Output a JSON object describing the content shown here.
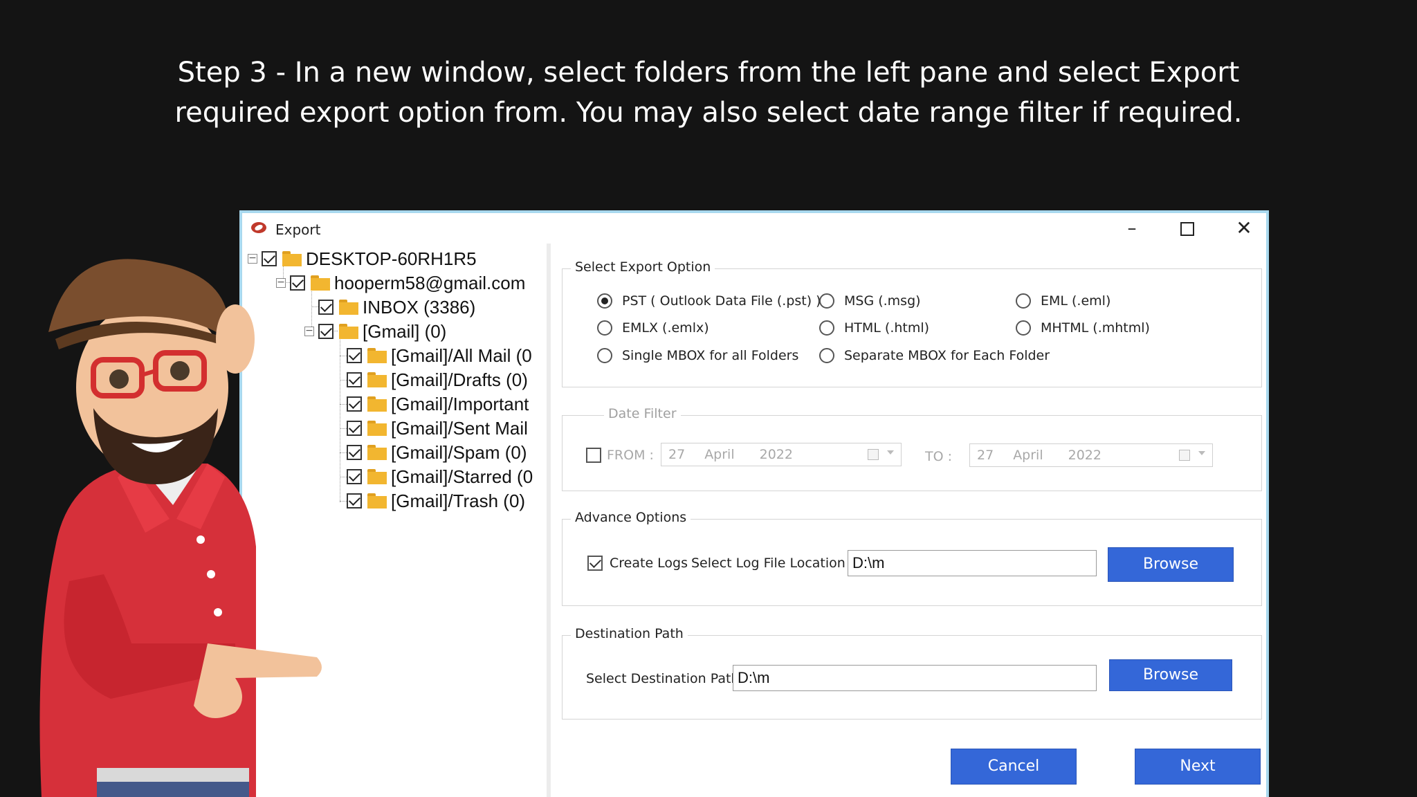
{
  "caption": {
    "line1": "Step 3 - In a new window, select folders from the left pane and select Export",
    "line2": "required export option from. You may also select date range filter if required."
  },
  "window": {
    "title": "Export",
    "minimize": "–",
    "close": "✕"
  },
  "tree": {
    "nodes": [
      {
        "label": "DESKTOP-60RH1R5",
        "checked": true
      },
      {
        "label": "hooperm58@gmail.com",
        "checked": true
      },
      {
        "label": "INBOX (3386)",
        "checked": true
      },
      {
        "label": "[Gmail] (0)",
        "checked": true
      },
      {
        "label": "[Gmail]/All Mail (0",
        "checked": true
      },
      {
        "label": "[Gmail]/Drafts (0)",
        "checked": true
      },
      {
        "label": "[Gmail]/Important",
        "checked": true
      },
      {
        "label": "[Gmail]/Sent Mail",
        "checked": true
      },
      {
        "label": "[Gmail]/Spam (0)",
        "checked": true
      },
      {
        "label": "[Gmail]/Starred (0",
        "checked": true
      },
      {
        "label": "[Gmail]/Trash (0)",
        "checked": true
      }
    ],
    "scroll_left": "‹"
  },
  "export_option": {
    "title": "Select Export Option",
    "options": [
      {
        "label": "PST ( Outlook Data File (.pst) )",
        "selected": true
      },
      {
        "label": "MSG  (.msg)",
        "selected": false
      },
      {
        "label": "EML  (.eml)",
        "selected": false
      },
      {
        "label": "EMLX  (.emlx)",
        "selected": false
      },
      {
        "label": "HTML  (.html)",
        "selected": false
      },
      {
        "label": "MHTML  (.mhtml)",
        "selected": false
      },
      {
        "label": "Single MBOX for all Folders",
        "selected": false
      },
      {
        "label": "Separate MBOX for Each Folder",
        "selected": false
      }
    ]
  },
  "date_filter": {
    "title": "Date Filter",
    "from_label": "FROM :",
    "to_label": "TO :",
    "from": {
      "day": "27",
      "month": "April",
      "year": "2022"
    },
    "to": {
      "day": "27",
      "month": "April",
      "year": "2022"
    },
    "enabled": false
  },
  "advance": {
    "title": "Advance Options",
    "create_logs": "Create Logs",
    "log_location_label": "Select Log File Location :",
    "log_location_value": "D:\\m",
    "browse": "Browse"
  },
  "destination": {
    "title": "Destination Path",
    "label": "Select Destination Path",
    "value": "D:\\m",
    "browse": "Browse"
  },
  "footer": {
    "cancel": "Cancel",
    "next": "Next"
  },
  "colors": {
    "button": "#3467d8",
    "window_border": "#a8d8ee",
    "folder": "#f2b630"
  }
}
